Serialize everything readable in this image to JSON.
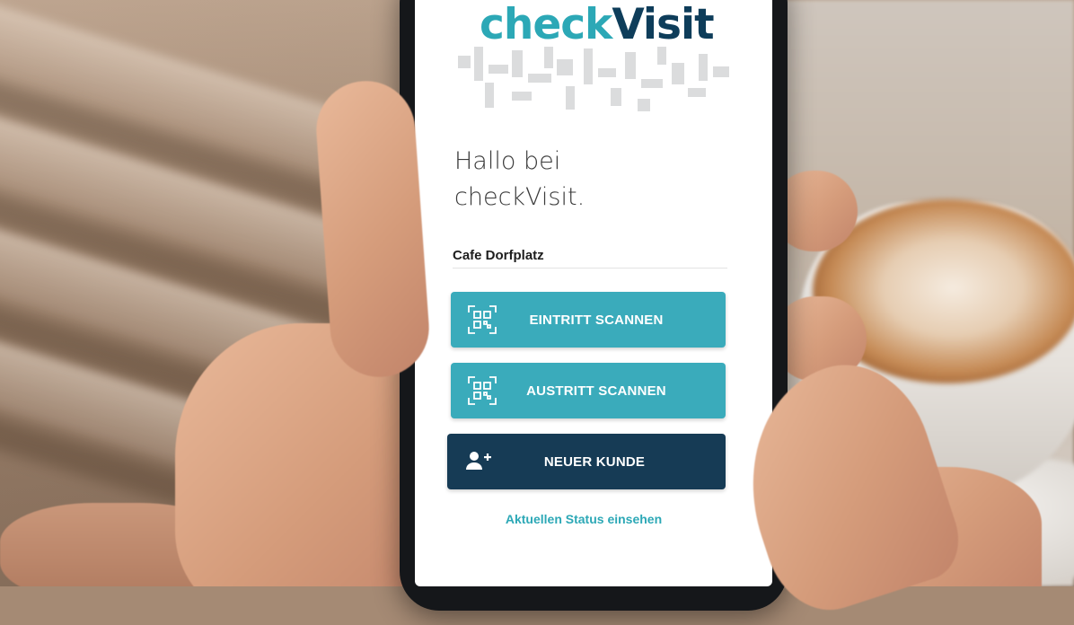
{
  "app": {
    "brand_part1": "check",
    "brand_part2": "Visit",
    "greeting_line1": "Hallo bei",
    "greeting_line2": "checkVisit."
  },
  "venue": {
    "name": "Cafe Dorfplatz"
  },
  "actions": [
    {
      "label": "EINTRITT SCANNEN",
      "icon": "qr-scan-icon",
      "color": "#3aabbb"
    },
    {
      "label": "AUSTRITT SCANNEN",
      "icon": "qr-scan-icon",
      "color": "#3aabbb"
    },
    {
      "label": "NEUER KUNDE",
      "icon": "add-user-icon",
      "color": "#163b55"
    }
  ],
  "status_link": "Aktuellen Status einsehen",
  "colors": {
    "accent": "#2ca8b6",
    "dark": "#163b55",
    "brand_dark": "#0e3d5a"
  }
}
